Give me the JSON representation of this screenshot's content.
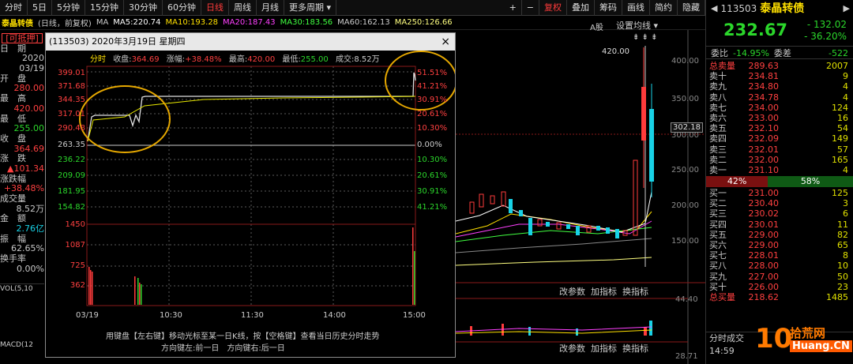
{
  "toolbar": {
    "items": [
      "分时",
      "5日",
      "5分钟",
      "15分钟",
      "30分钟",
      "60分钟",
      "日线",
      "周线",
      "月线",
      "更多周期"
    ],
    "active": "日线",
    "right_items": [
      "+",
      "−",
      "复权",
      "叠加",
      "筹码",
      "画线",
      "简约",
      "隐藏"
    ]
  },
  "ma_bar": {
    "name": "泰晶转债",
    "mode": "(日线，前复权)",
    "ma": "MA",
    "ma5": "MA5:220.74",
    "ma10": "MA10:193.28",
    "ma20": "MA20:187.43",
    "ma30": "MA30:183.56",
    "ma60": "MA60:162.13",
    "ma250": "MA250:126.66"
  },
  "sidebar": {
    "badge": "[可抵押]",
    "date_label": "日　期",
    "date_year": "2020",
    "date_md": "03/19",
    "open_label": "开　盘",
    "open": "280.00",
    "high_label": "最　高",
    "high": "420.00",
    "low_label": "最　低",
    "low": "255.00",
    "close_label": "收　盘",
    "close": "364.69",
    "chg_label": "涨　跌",
    "chg": "▲101.34",
    "pct_label": "涨跌幅",
    "pct": "+38.48%",
    "vol_label": "成交量",
    "vol": "8.52万",
    "amt_label": "金　额",
    "amt": "2.76亿",
    "amp_label": "振　幅",
    "amp": "62.65%",
    "turn_label": "换手率",
    "turn": "0.00%",
    "vol_ind": "VOL(5,10",
    "macd_ind": "MACD(12"
  },
  "popup": {
    "title": "(113503) 2020年3月19日 星期四",
    "close": "×",
    "tab": "分时",
    "info_close_l": "收盘:",
    "info_close": "364.69",
    "info_pct_l": "涨幅:",
    "info_pct": "+38.48%",
    "info_high_l": "最高:",
    "info_high": "420.00",
    "info_low_l": "最低:",
    "info_low": "255.00",
    "info_vol_l": "成交:",
    "info_vol": "8.52万",
    "y_left": [
      "399.01",
      "371.68",
      "344.35",
      "317.01",
      "290.48",
      "263.35",
      "236.22",
      "209.09",
      "181.95",
      "154.82"
    ],
    "y_right": [
      "51.51%",
      "41.21%",
      "30.91%",
      "20.61%",
      "10.30%",
      "0.00%",
      "10.30%",
      "20.61%",
      "30.91%",
      "41.21%"
    ],
    "vol_left": [
      "1450",
      "1087",
      "725",
      "362"
    ],
    "x_labels": [
      "03/19",
      "10:30",
      "11:30",
      "14:00",
      "15:00"
    ],
    "hint1": "用键盘【左右键】移动光标至某一日K线，按【空格键】查看当日历史分时走势",
    "hint2": "方向键左:前一日　方向键右:后一日"
  },
  "kchart": {
    "agu": "A股",
    "setma": "设置均线",
    "peak": "420.00",
    "cur": "302.18",
    "yaxis": [
      "400.00",
      "350.00",
      "300.00",
      "250.00",
      "200.00",
      "150.00"
    ],
    "ind1": "改参数",
    "ind2": "加指标",
    "ind3": "换指标",
    "v1": "44.40",
    "v2": "28.71"
  },
  "quote": {
    "code": "113503",
    "name": "泰晶转债",
    "price": "232.67",
    "chg": "- 132.02",
    "pct": "- 36.20%",
    "wb_l": "委比",
    "wb": "-14.95%",
    "wc_l": "委差",
    "wc": "-522",
    "sell_total_l": "总卖量",
    "sell_total_p": "289.63",
    "sell_total_v": "2007",
    "sells": [
      [
        "卖十",
        "234.81",
        "9"
      ],
      [
        "卖九",
        "234.80",
        "4"
      ],
      [
        "卖八",
        "234.78",
        "4"
      ],
      [
        "卖七",
        "234.00",
        "124"
      ],
      [
        "卖六",
        "233.00",
        "16"
      ],
      [
        "卖五",
        "232.10",
        "54"
      ],
      [
        "卖四",
        "232.09",
        "149"
      ],
      [
        "卖三",
        "232.01",
        "57"
      ],
      [
        "卖二",
        "232.00",
        "165"
      ],
      [
        "卖一",
        "231.10",
        "4"
      ]
    ],
    "ratio_l": "42%",
    "ratio_r": "58%",
    "buys": [
      [
        "买一",
        "231.00",
        "125"
      ],
      [
        "买二",
        "230.40",
        "3"
      ],
      [
        "买三",
        "230.02",
        "6"
      ],
      [
        "买四",
        "230.01",
        "11"
      ],
      [
        "买五",
        "229.00",
        "82"
      ],
      [
        "买六",
        "229.00",
        "65"
      ],
      [
        "买七",
        "228.01",
        "8"
      ],
      [
        "买八",
        "228.00",
        "10"
      ],
      [
        "买九",
        "227.00",
        "50"
      ],
      [
        "买十",
        "226.00",
        "23"
      ]
    ],
    "buy_total_l": "总买量",
    "buy_total_p": "218.62",
    "buy_total_v": "1485",
    "tab": "分时成交",
    "time": "14:59",
    "brand_a": "拾荒网",
    "brand_b": "Huang.CN",
    "brand_10": "10"
  },
  "colors": {
    "red": "#ff3b3b",
    "green": "#2bd62b",
    "cyan": "#18d2e6",
    "yellow": "#e8e800"
  }
}
